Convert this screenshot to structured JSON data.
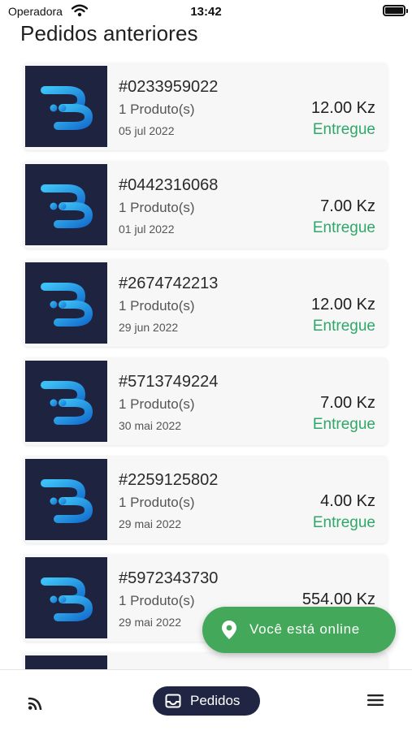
{
  "status_bar": {
    "carrier": "Operadora",
    "time": "13:42"
  },
  "page": {
    "title": "Pedidos anteriores"
  },
  "orders": [
    {
      "id": "#0233959022",
      "count": "1 Produto(s)",
      "date": "05 jul 2022",
      "price": "12.00 Kz",
      "status": "Entregue"
    },
    {
      "id": "#0442316068",
      "count": "1 Produto(s)",
      "date": "01 jul 2022",
      "price": "7.00 Kz",
      "status": "Entregue"
    },
    {
      "id": "#2674742213",
      "count": "1 Produto(s)",
      "date": "29 jun 2022",
      "price": "12.00 Kz",
      "status": "Entregue"
    },
    {
      "id": "#5713749224",
      "count": "1 Produto(s)",
      "date": "30 mai 2022",
      "price": "7.00 Kz",
      "status": "Entregue"
    },
    {
      "id": "#2259125802",
      "count": "1 Produto(s)",
      "date": "29 mai 2022",
      "price": "4.00 Kz",
      "status": "Entregue"
    },
    {
      "id": "#5972343730",
      "count": "1 Produto(s)",
      "date": "29 mai 2022",
      "price": "554.00 Kz",
      "status": ""
    },
    {
      "id": "",
      "count": "",
      "date": "",
      "price": "",
      "status": ""
    }
  ],
  "online_button": {
    "label": "Você está online",
    "icon": "location-pin-icon"
  },
  "bottom_nav": {
    "feed_icon": "rss-feed-icon",
    "orders_label": "Pedidos",
    "orders_icon": "inbox-icon",
    "menu_icon": "hamburger-menu-icon"
  },
  "colors": {
    "status_delivered": "#2ea868",
    "online_button": "#43a85a",
    "nav_active": "#1f2542",
    "logo_background": "#1e2340",
    "logo_blue": "#1ea2e6"
  }
}
